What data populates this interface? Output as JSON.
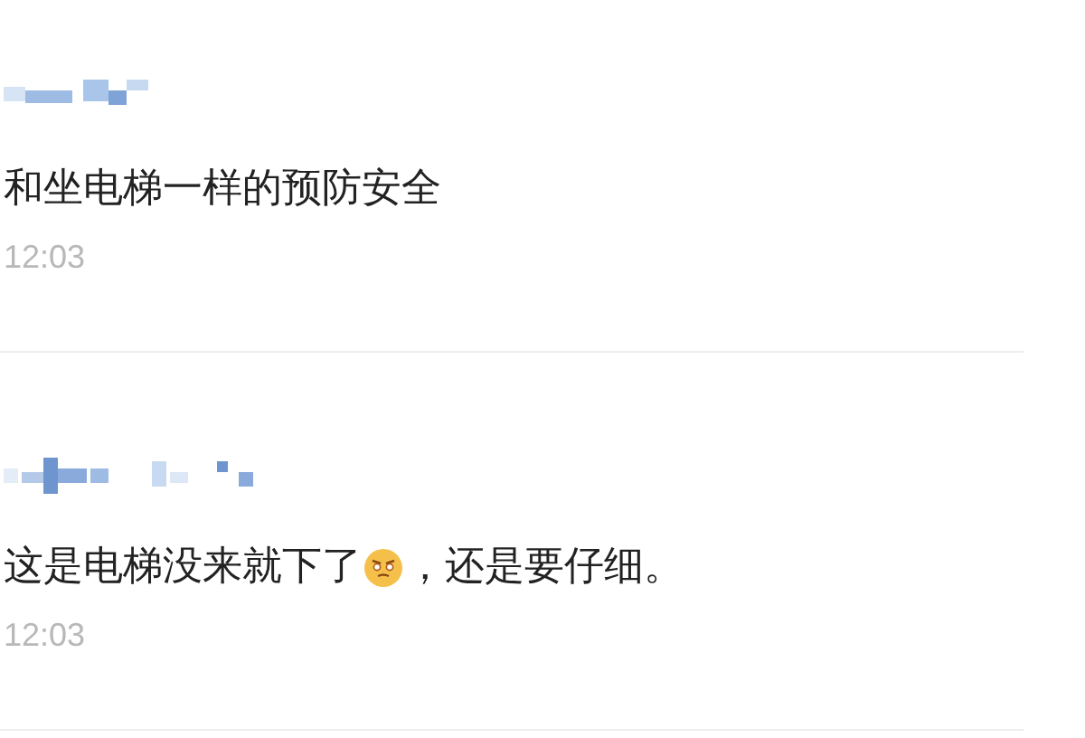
{
  "comments": [
    {
      "parts": [
        {
          "kind": "text",
          "text": "和坐电梯一样的预防安全"
        }
      ],
      "time": "12:03"
    },
    {
      "parts": [
        {
          "kind": "text",
          "text": "这是电梯没来就下了"
        },
        {
          "kind": "emoji"
        },
        {
          "kind": "text",
          "text": "，还是要仔细。"
        }
      ],
      "time": "12:03"
    }
  ]
}
